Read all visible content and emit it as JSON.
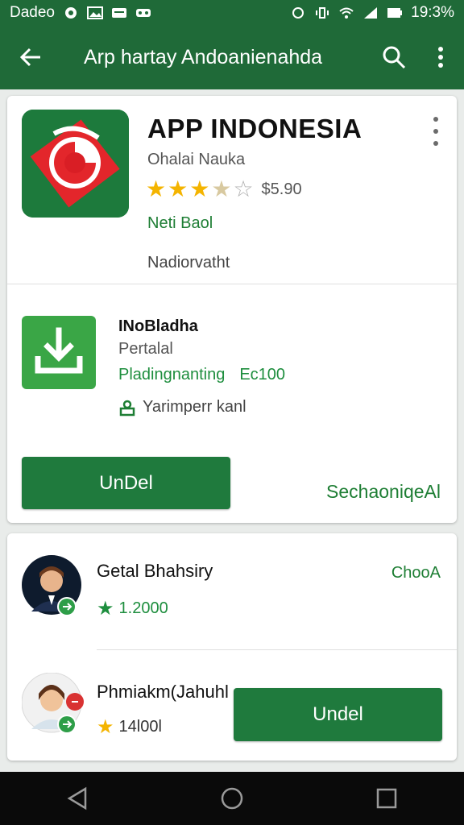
{
  "status_bar": {
    "carrier": "Dadeo",
    "time": "19:3%"
  },
  "app_bar": {
    "title": "Arp hartay Andoanienahda"
  },
  "app_header": {
    "name": "APP INDONESIA",
    "developer": "Ohalai Nauka",
    "rating_stars": 3.5,
    "price": "$5.90",
    "tag": "Neti Baol",
    "note": "Nadiorvatht"
  },
  "download": {
    "title": "INoBladha",
    "subtitle": "Pertalal",
    "progress_label": "Pladingnanting",
    "progress_value": "Ec100",
    "user_text": "Yarimperr kanl"
  },
  "actions": {
    "primary_label": "UnDel",
    "secondary_label": "SechaoniqeAl"
  },
  "reviews": [
    {
      "name": "Getal Bhahsiry",
      "rating": "1.2000",
      "action": "ChooA"
    },
    {
      "name": "Phmiakm(Jahuhl",
      "rating": "14l00l",
      "button_label": "Undel"
    }
  ],
  "colors": {
    "brand_green": "#1f6a38",
    "button_green": "#1f7a3d",
    "accent_green": "#1e8e3e",
    "star": "#f4b400"
  }
}
